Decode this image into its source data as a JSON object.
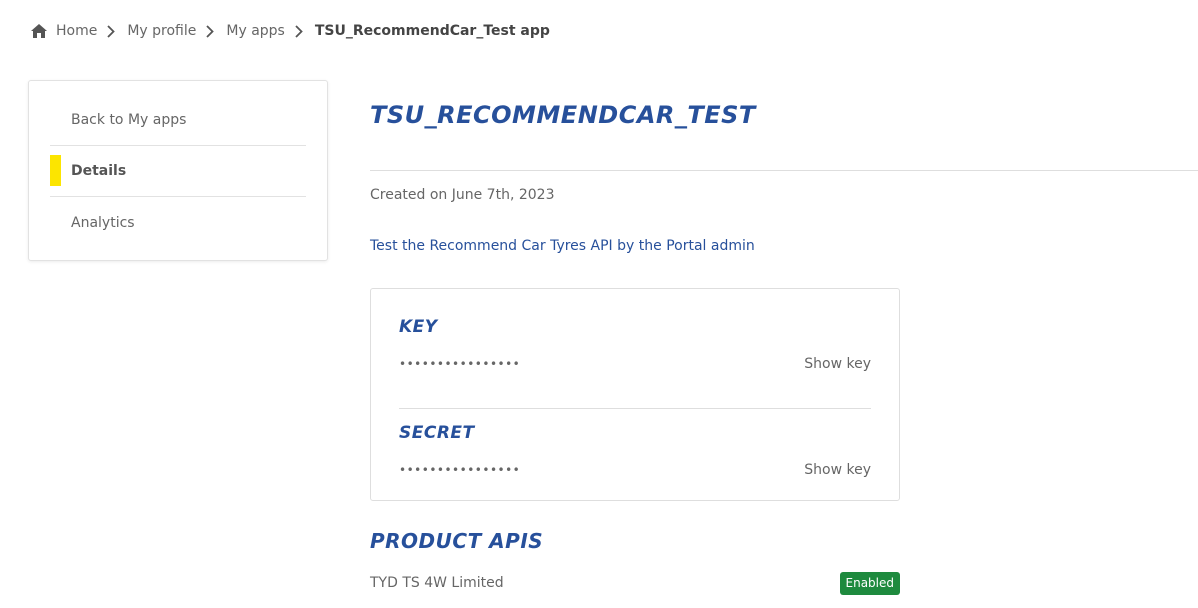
{
  "breadcrumb": {
    "items": [
      "Home",
      "My profile",
      "My apps"
    ],
    "current": "TSU_RecommendCar_Test app"
  },
  "sidebar": {
    "items": [
      {
        "label": "Back to My apps",
        "active": false
      },
      {
        "label": "Details",
        "active": true
      },
      {
        "label": "Analytics",
        "active": false
      }
    ]
  },
  "app": {
    "title": "TSU_RECOMMENDCAR_TEST",
    "created": "Created on June 7th, 2023",
    "description": "Test the Recommend Car Tyres API by the Portal admin"
  },
  "credentials": {
    "key": {
      "label": "KEY",
      "masked": "••••••••••••••••",
      "action": "Show key"
    },
    "secret": {
      "label": "SECRET",
      "masked": "••••••••••••••••",
      "action": "Show key"
    }
  },
  "products": {
    "heading": "PRODUCT APIS",
    "items": [
      {
        "name": "TYD TS 4W Limited",
        "status": "Enabled"
      }
    ]
  },
  "colors": {
    "accent": "#27509b",
    "active_marker": "#fce500",
    "enabled_badge": "#1e8a3e"
  }
}
